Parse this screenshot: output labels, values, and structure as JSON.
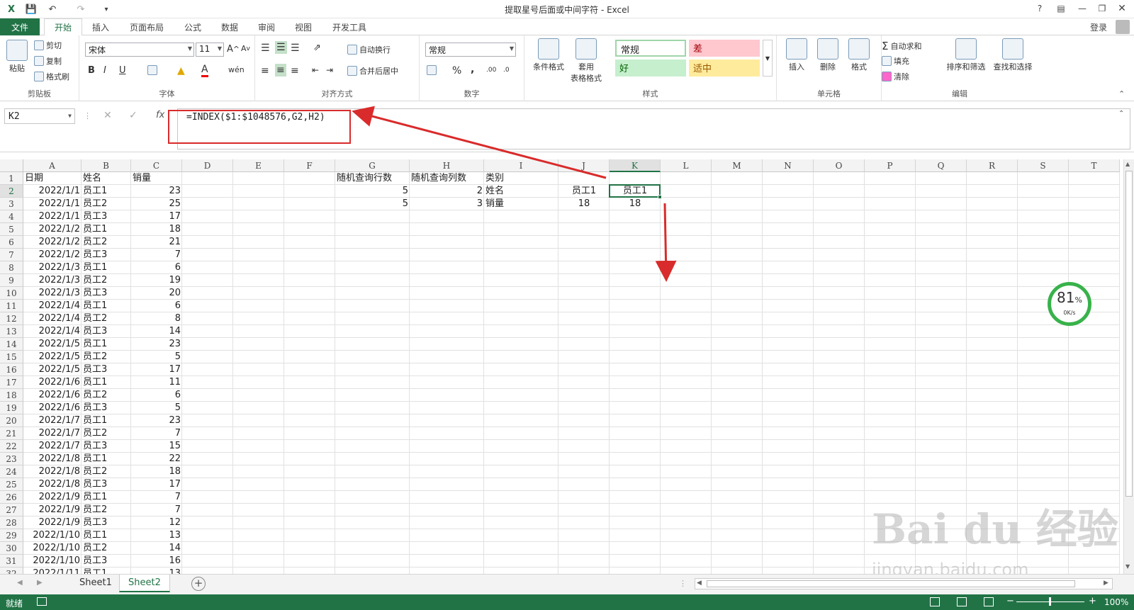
{
  "titlebar": {
    "title": "提取星号后面或中间字符 - Excel",
    "login": "登录",
    "help": "?"
  },
  "tabs": [
    {
      "label": "文件"
    },
    {
      "label": "开始"
    },
    {
      "label": "插入"
    },
    {
      "label": "页面布局"
    },
    {
      "label": "公式"
    },
    {
      "label": "数据"
    },
    {
      "label": "审阅"
    },
    {
      "label": "视图"
    },
    {
      "label": "开发工具"
    }
  ],
  "ribbon": {
    "clipboard": {
      "label": "剪贴板",
      "paste": "粘贴",
      "cut": "剪切",
      "copy": "复制",
      "format_painter": "格式刷"
    },
    "font": {
      "label": "字体",
      "font_name": "宋体",
      "font_size": "11",
      "bold": "B",
      "italic": "I",
      "underline": "U"
    },
    "alignment": {
      "label": "对齐方式",
      "wrap": "自动换行",
      "merge": "合并后居中"
    },
    "number": {
      "label": "数字",
      "format": "常规",
      "percent": "%",
      "comma": ","
    },
    "styles": {
      "label": "样式",
      "conditional": "条件格式",
      "table_l1": "套用",
      "table_l2": "表格格式",
      "normal": "常规",
      "bad": "差",
      "good": "好",
      "neutral": "适中"
    },
    "cells": {
      "label": "单元格",
      "insert": "插入",
      "delete": "删除",
      "format": "格式"
    },
    "editing": {
      "label": "编辑",
      "autosum": "自动求和",
      "fill": "填充",
      "clear": "清除",
      "sort_filter": "排序和筛选",
      "find_select": "查找和选择"
    }
  },
  "formula_bar": {
    "name_box": "K2",
    "fx": "fx",
    "formula": "=INDEX($1:$1048576,G2,H2)"
  },
  "columns": [
    "A",
    "B",
    "C",
    "D",
    "E",
    "F",
    "G",
    "H",
    "I",
    "J",
    "K",
    "L",
    "M",
    "N",
    "O",
    "P",
    "Q",
    "R",
    "S",
    "T"
  ],
  "selected_column": "K",
  "rows_visible": [
    "1",
    "2",
    "3",
    "4",
    "5",
    "6",
    "7",
    "8",
    "9",
    "10",
    "11",
    "12",
    "13",
    "14",
    "15",
    "16",
    "17",
    "18",
    "19",
    "20",
    "21",
    "22",
    "23",
    "24",
    "25",
    "26",
    "27",
    "28",
    "29",
    "30",
    "31",
    "32"
  ],
  "selected_row": "2",
  "sheet": {
    "headers": {
      "A": "日期",
      "B": "姓名",
      "C": "销量",
      "G": "随机查询行数",
      "H": "随机查询列数",
      "I": "类别"
    },
    "lookup": [
      {
        "G": "5",
        "H": "2",
        "I": "姓名",
        "J": "员工1",
        "K": "员工1"
      },
      {
        "G": "5",
        "H": "3",
        "I": "销量",
        "J": "18",
        "K": "18"
      }
    ],
    "data": [
      [
        "2022/1/1",
        "员工1",
        "23"
      ],
      [
        "2022/1/1",
        "员工2",
        "25"
      ],
      [
        "2022/1/1",
        "员工3",
        "17"
      ],
      [
        "2022/1/2",
        "员工1",
        "18"
      ],
      [
        "2022/1/2",
        "员工2",
        "21"
      ],
      [
        "2022/1/2",
        "员工3",
        "7"
      ],
      [
        "2022/1/3",
        "员工1",
        "6"
      ],
      [
        "2022/1/3",
        "员工2",
        "19"
      ],
      [
        "2022/1/3",
        "员工3",
        "20"
      ],
      [
        "2022/1/4",
        "员工1",
        "6"
      ],
      [
        "2022/1/4",
        "员工2",
        "8"
      ],
      [
        "2022/1/4",
        "员工3",
        "14"
      ],
      [
        "2022/1/5",
        "员工1",
        "23"
      ],
      [
        "2022/1/5",
        "员工2",
        "5"
      ],
      [
        "2022/1/5",
        "员工3",
        "17"
      ],
      [
        "2022/1/6",
        "员工1",
        "11"
      ],
      [
        "2022/1/6",
        "员工2",
        "6"
      ],
      [
        "2022/1/6",
        "员工3",
        "5"
      ],
      [
        "2022/1/7",
        "员工1",
        "23"
      ],
      [
        "2022/1/7",
        "员工2",
        "7"
      ],
      [
        "2022/1/7",
        "员工3",
        "15"
      ],
      [
        "2022/1/8",
        "员工1",
        "22"
      ],
      [
        "2022/1/8",
        "员工2",
        "18"
      ],
      [
        "2022/1/8",
        "员工3",
        "17"
      ],
      [
        "2022/1/9",
        "员工1",
        "7"
      ],
      [
        "2022/1/9",
        "员工2",
        "7"
      ],
      [
        "2022/1/9",
        "员工3",
        "12"
      ],
      [
        "2022/1/10",
        "员工1",
        "13"
      ],
      [
        "2022/1/10",
        "员工2",
        "14"
      ],
      [
        "2022/1/10",
        "员工3",
        "16"
      ],
      [
        "2022/1/11",
        "员工1",
        "13"
      ]
    ]
  },
  "sheet_tabs": [
    {
      "label": "Sheet1"
    },
    {
      "label": "Sheet2"
    }
  ],
  "active_sheet": "Sheet2",
  "status": {
    "ready": "就绪",
    "zoom": "100%"
  },
  "network_widget": {
    "percent": "81",
    "unit": "%",
    "speed": "0K/s"
  },
  "watermark": {
    "main": "Bai du 经验",
    "sub": "jingyan.baidu.com"
  },
  "colors": {
    "excel_green": "#217346",
    "annotation_red": "#d92b2b",
    "bad_bg": "#ffc7ce",
    "good_bg": "#c6efce",
    "neutral_bg": "#ffeb9c",
    "net_ring": "#38b24b"
  }
}
